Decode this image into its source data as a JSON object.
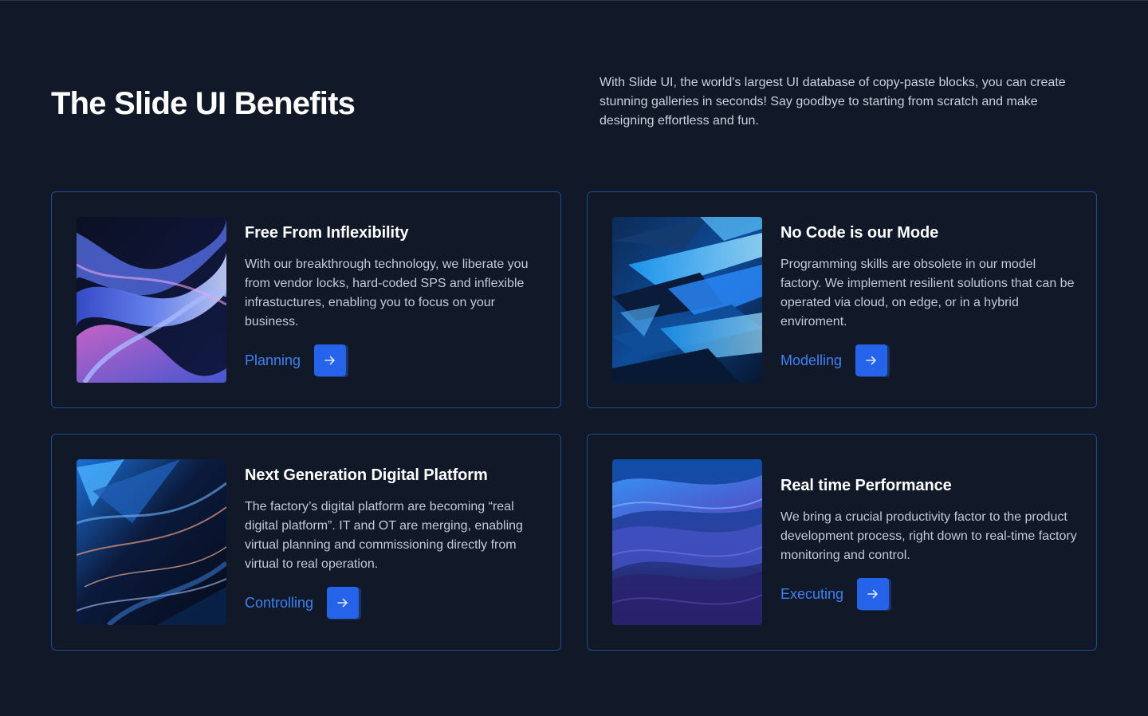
{
  "section": {
    "title": "The Slide UI Benefits",
    "intro": "With Slide UI, the world's largest UI database of copy-paste blocks, you can create stunning galleries in seconds! Say goodbye to starting from scratch and make designing effortless and fun."
  },
  "cards": [
    {
      "title": "Free From Inflexibility",
      "text": "With our breakthrough technology, we liberate you from vendor locks, hard-coded SPS and inflexible infrastuctures, enabling you to focus on your business.",
      "link_label": "Planning",
      "icon": "arrow-right-icon"
    },
    {
      "title": "No Code is our Mode",
      "text": "Programming skills are obsolete in our model factory. We implement resilient solutions that can be operated via cloud, on edge, or in a hybrid enviroment.",
      "link_label": "Modelling",
      "icon": "arrow-right-icon"
    },
    {
      "title": "Next Generation Digital Platform",
      "text": "The factory’s digital platform are becoming “real digital platform”. IT and OT are merging, enabling virtual planning and commissioning directly from virtual to real operation.",
      "link_label": "Controlling",
      "icon": "arrow-right-icon"
    },
    {
      "title": "Real time Performance",
      "text": "We bring a crucial productivity factor to the product development process, right down to real-time factory monitoring and control.",
      "link_label": "Executing",
      "icon": "arrow-right-icon"
    }
  ],
  "colors": {
    "background": "#111827",
    "card_border": "#1e4b8f",
    "accent": "#3b82f6",
    "button": "#2563eb"
  }
}
